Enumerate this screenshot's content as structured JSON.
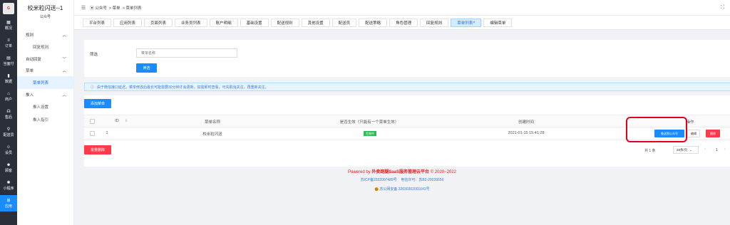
{
  "left_nav": [
    {
      "label": "概况",
      "icon": "grid-icon"
    },
    {
      "label": "订单",
      "icon": "list-icon"
    },
    {
      "label": "当面付",
      "icon": "receipt-icon"
    },
    {
      "label": "数据",
      "icon": "chart-icon"
    },
    {
      "label": "商户",
      "icon": "store-icon"
    },
    {
      "label": "售后",
      "icon": "headset-icon"
    },
    {
      "label": "配送员",
      "icon": "courier-icon"
    },
    {
      "label": "设员",
      "icon": "person-icon"
    },
    {
      "label": "顾客",
      "icon": "customer-icon"
    },
    {
      "label": "小程序",
      "icon": "miniapp-icon"
    },
    {
      "label": "应用",
      "icon": "apps-icon"
    }
  ],
  "sidebar": {
    "title": "校米粒闪送--1",
    "subtitle": "公众号",
    "groups": [
      {
        "label": "规则",
        "items": [
          "回复规则"
        ]
      },
      {
        "label": "自动回复",
        "items": []
      },
      {
        "label": "菜单",
        "items": [
          "菜单列表"
        ]
      },
      {
        "label": "推入",
        "items": [
          "推入设置",
          "推入指引"
        ]
      }
    ]
  },
  "breadcrumb": [
    "公众号",
    "菜单",
    "菜单列表"
  ],
  "tabs": [
    "平台列表",
    "应用列表",
    "页面列表",
    "业务员列表",
    "账户明细",
    "基础设置",
    "配送规则",
    "其他设置",
    "配送员",
    "配送策略",
    "角色管理",
    "回复规则",
    "菜单列表",
    "编辑菜单"
  ],
  "filter": {
    "label": "筛选",
    "placeholder": "菜单名称",
    "button": "筛选"
  },
  "notice": "由于微信接口延迟，菜单修改后最长可能需要30分钟才会更新。如需即时查看，可先取消关注，再重新关注。",
  "add_button": "添加菜单",
  "table": {
    "headers": [
      "ID",
      "菜单名称",
      "是否生效（只能有一个菜单生效）",
      "创建时间",
      "操作"
    ],
    "rows": [
      {
        "id": "1",
        "name": "校米粒闪送",
        "status": "生效中",
        "created": "2021-01-15 15:41:28",
        "actions": [
          "推送到公众号",
          "编辑",
          "删除"
        ]
      }
    ]
  },
  "bulk_delete": "批量删除",
  "pagination": {
    "total": "共 1 条",
    "page_size": "20条/页",
    "current": "1"
  },
  "footer": {
    "powered_prefix": "Powered by",
    "brand": "外卖跑腿SaaS服务管理云平台",
    "copyright": "© 2020~2022",
    "icp": "苏ICP备2022007489号",
    "license": "电信许可：苏B2-20220556",
    "police": "苏公网安备 32030302001041号"
  },
  "colors": {
    "accent": "#1a8cff",
    "danger": "#ff3b4a",
    "highlight_box": "#e0001b",
    "success": "#2dbd55",
    "footer_red": "#d22"
  }
}
